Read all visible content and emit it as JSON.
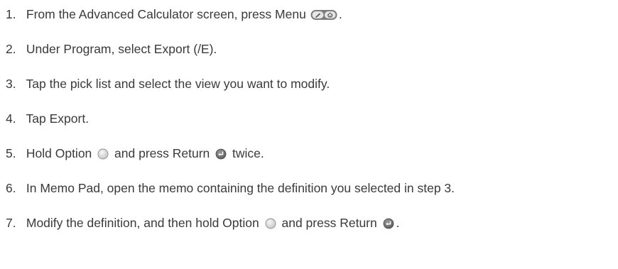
{
  "steps": [
    {
      "number": "1.",
      "text": "From the Advanced Calculator screen, press Menu",
      "after": "."
    },
    {
      "number": "2.",
      "text": "Under Program, select Export (/E)."
    },
    {
      "number": "3.",
      "text": "Tap the pick list and select the view you want to modify."
    },
    {
      "number": "4.",
      "text": "Tap Export."
    },
    {
      "number": "5.",
      "text_before_option": "Hold Option",
      "text_between": "and press Return",
      "text_after": "twice."
    },
    {
      "number": "6.",
      "text": "In Memo Pad, open the memo containing the definition you selected in step 3."
    },
    {
      "number": "7.",
      "text_before_option": "Modify the definition, and then hold Option",
      "text_between": "and press Return",
      "text_after": "."
    }
  ],
  "icons": {
    "menu": "menu-key-icon",
    "option": "option-key-icon",
    "return": "return-key-icon"
  },
  "colors": {
    "text": "#3a3a3a",
    "key_fill": "#d9d9d9",
    "key_stroke": "#9a9a9a",
    "return_fill": "#7a7a7a"
  }
}
